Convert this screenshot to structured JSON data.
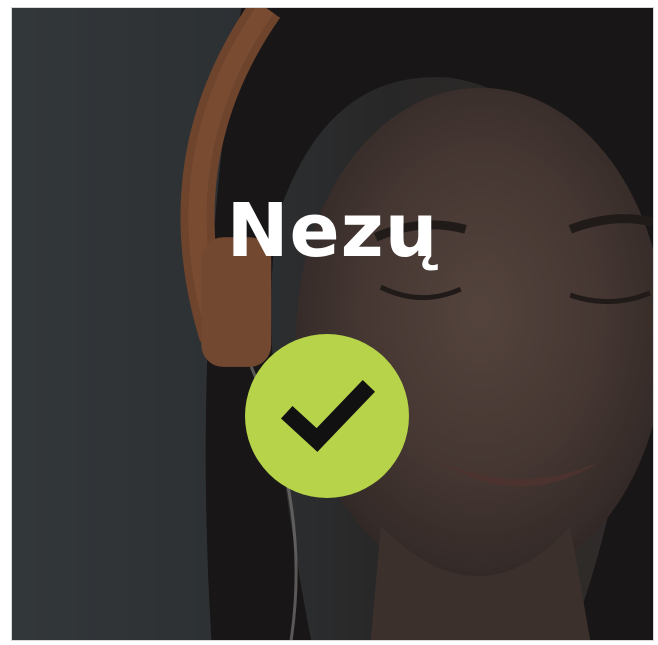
{
  "card": {
    "title": "Nezų",
    "image_subject": "woman-with-headphones-photo",
    "status_icon": "check-icon"
  },
  "colors": {
    "badge": "#b6d34a",
    "check": "#111111",
    "title": "#ffffff",
    "overlay": "#2a2d2f",
    "headphones": "#d8834e"
  }
}
